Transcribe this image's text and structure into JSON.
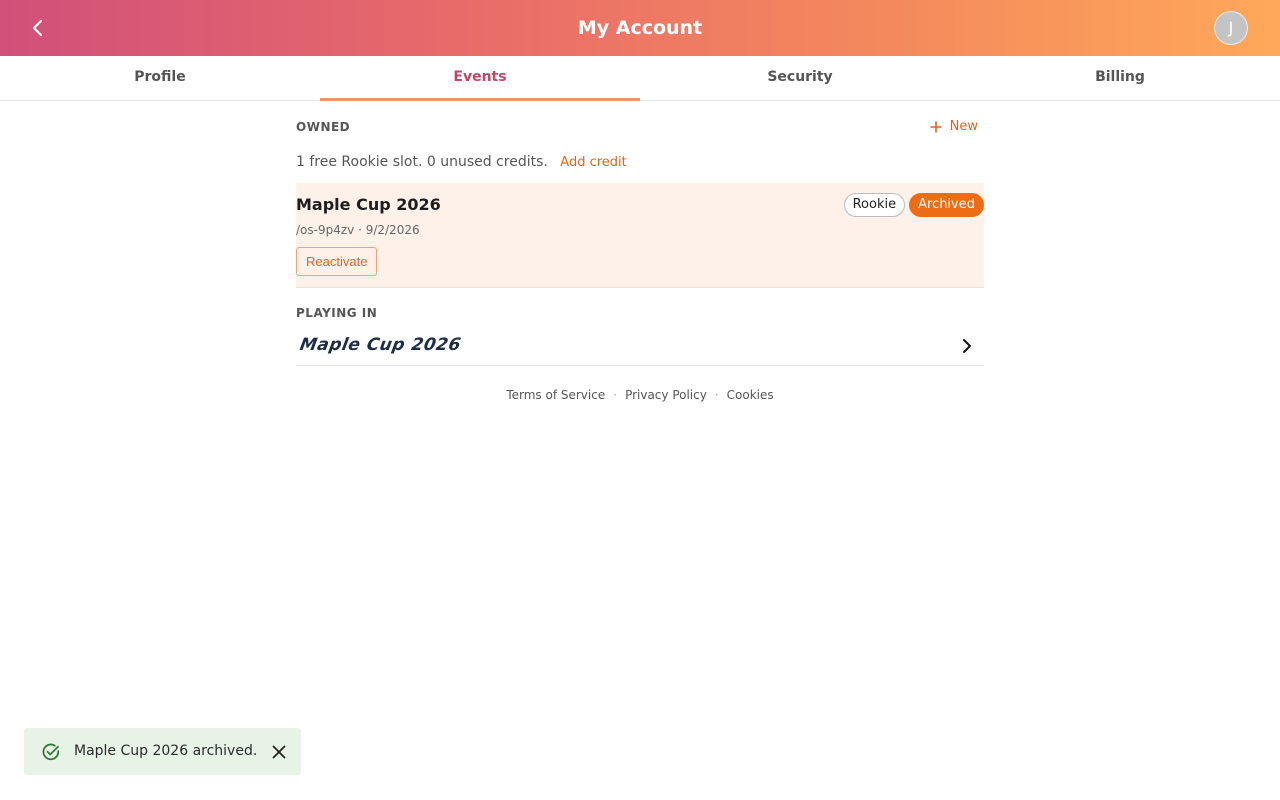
{
  "header": {
    "title": "My Account",
    "back_icon": "chevron-left-icon",
    "avatar_initial": "J"
  },
  "tabs": [
    {
      "label": "Profile",
      "active": false
    },
    {
      "label": "Events",
      "active": true
    },
    {
      "label": "Security",
      "active": false
    },
    {
      "label": "Billing",
      "active": false
    }
  ],
  "owned": {
    "section_label": "OWNED",
    "new_label": "New",
    "credits_text": "1 free Rookie slot. 0 unused credits.",
    "add_credit_label": "Add credit",
    "events": [
      {
        "name": "Maple Cup 2026",
        "meta": "/os-9p4zv · 9/2/2026",
        "badges": [
          "Rookie",
          "Archived"
        ],
        "action_label": "Reactivate"
      }
    ]
  },
  "playing_in": {
    "section_label": "PLAYING IN",
    "items": [
      {
        "logo_text": "Maple Cup 2026"
      }
    ]
  },
  "footer": {
    "links": [
      "Terms of Service",
      "Privacy Policy",
      "Cookies"
    ],
    "separator": "·"
  },
  "toast": {
    "message": "Maple Cup 2026 archived.",
    "icon": "check-circle-icon",
    "close_icon": "close-icon"
  },
  "colors": {
    "accent": "#e0651c",
    "active_tab": "#c74463",
    "archived_badge": "#ee6c15",
    "card_bg": "#fdf1ea",
    "toast_bg": "#e8f3e8",
    "toast_icon": "#2e7d32"
  }
}
